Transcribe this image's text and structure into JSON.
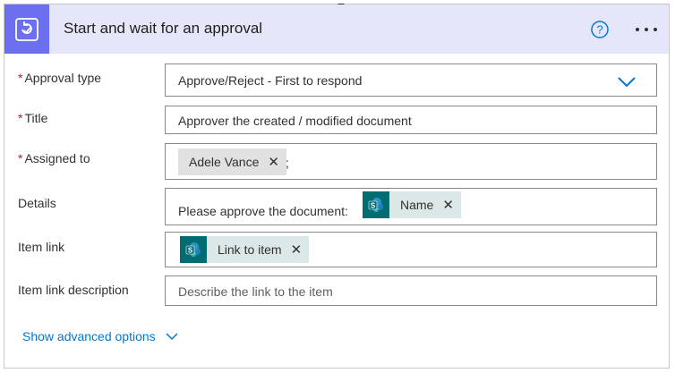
{
  "header": {
    "title": "Start and wait for an approval",
    "icon": "approval-icon",
    "help_icon": "question-circle-icon",
    "more_icon": "ellipsis-icon",
    "bg_color": "#e6e6fb",
    "icon_bg": "#6c6ff0"
  },
  "fields": {
    "approval_type": {
      "label": "Approval type",
      "required_mark": "*",
      "value": "Approve/Reject - First to respond"
    },
    "title": {
      "label": "Title",
      "required_mark": "*",
      "value": "Approver the created / modified document"
    },
    "assigned_to": {
      "label": "Assigned to",
      "required_mark": "*",
      "token": "Adele Vance",
      "separator": ";"
    },
    "details": {
      "label": "Details",
      "text": "Please approve the document:",
      "token": "Name"
    },
    "item_link": {
      "label": "Item link",
      "token": "Link to item"
    },
    "item_link_description": {
      "label": "Item link description",
      "placeholder": "Describe the link to the item"
    }
  },
  "advanced": {
    "label": "Show advanced options"
  },
  "colors": {
    "required": "#a4262c",
    "link": "#0078d4",
    "sharepoint": "#036c70"
  }
}
